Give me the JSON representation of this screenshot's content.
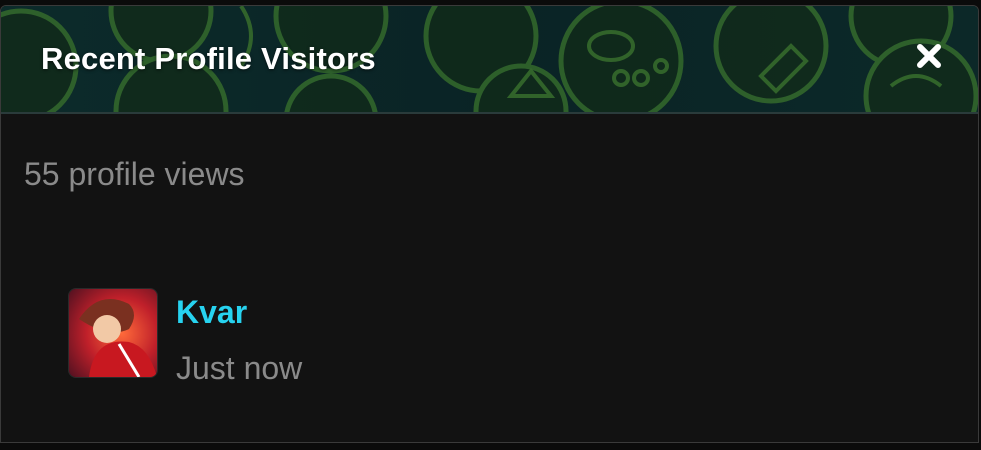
{
  "widget": {
    "title": "Recent Profile Visitors",
    "close_icon": "close-icon",
    "summary": "55 profile views"
  },
  "visitors": [
    {
      "name": "Kvar",
      "time": "Just now",
      "avatar_icon": "avatar"
    }
  ],
  "colors": {
    "header_bg": "#0e2a2a",
    "pattern_stroke": "#3a7a3a",
    "name_link": "#27d3f0",
    "muted_text": "#8a8a8a",
    "panel_bg": "#121212"
  }
}
